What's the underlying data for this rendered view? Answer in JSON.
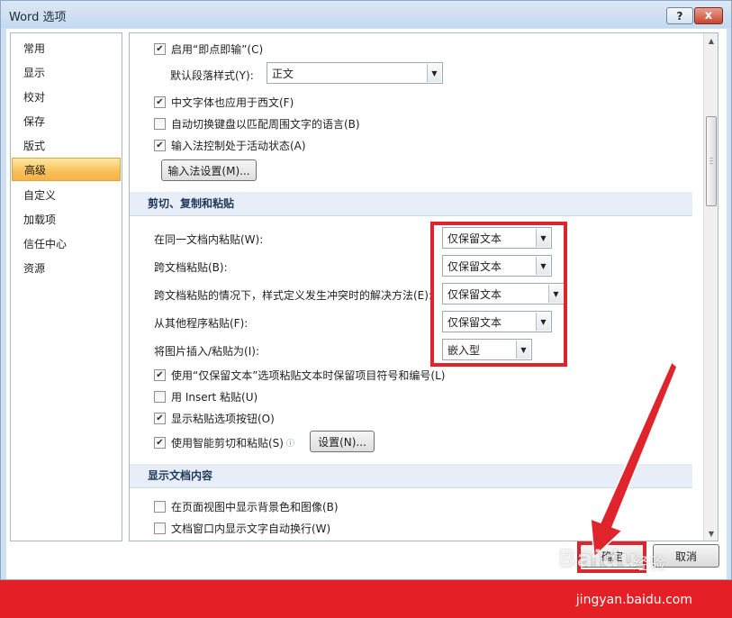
{
  "window": {
    "title": "Word 选项",
    "help_label": "?",
    "close_label": "x"
  },
  "sidebar": {
    "items": [
      {
        "label": "常用"
      },
      {
        "label": "显示"
      },
      {
        "label": "校对"
      },
      {
        "label": "保存"
      },
      {
        "label": "版式"
      },
      {
        "label": "高级",
        "active": true
      },
      {
        "label": "自定义"
      },
      {
        "label": "加载项"
      },
      {
        "label": "信任中心"
      },
      {
        "label": "资源"
      }
    ]
  },
  "editing": {
    "click_and_type": {
      "label": "启用“即点即输”(C)",
      "checked": true
    },
    "default_para_style": {
      "label": "默认段落样式(Y):",
      "value": "正文"
    },
    "chinese_font_west": {
      "label": "中文字体也应用于西文(F)",
      "checked": true
    },
    "auto_switch_keyboard": {
      "label": "自动切换键盘以匹配周围文字的语言(B)",
      "checked": false
    },
    "ime_control": {
      "label": "输入法控制处于活动状态(A)",
      "checked": true
    },
    "ime_settings_button": "输入法设置(M)..."
  },
  "cut_copy_paste": {
    "section_title": "剪切、复制和粘贴",
    "options": [
      {
        "label": "在同一文档内粘贴(W):",
        "value": "仅保留文本"
      },
      {
        "label": "跨文档粘贴(B):",
        "value": "仅保留文本"
      },
      {
        "label": "跨文档粘贴的情况下，样式定义发生冲突时的解决方法(E):",
        "value": "仅保留文本"
      },
      {
        "label": "从其他程序粘贴(F):",
        "value": "仅保留文本"
      },
      {
        "label": "将图片插入/粘贴为(I):",
        "value": "嵌入型"
      }
    ],
    "keep_bullets": {
      "label": "使用“仅保留文本”选项粘贴文本时保留项目符号和编号(L)",
      "checked": true
    },
    "insert_paste": {
      "label": "用 Insert 粘贴(U)",
      "checked": false
    },
    "show_paste_options": {
      "label": "显示粘贴选项按钮(O)",
      "checked": true
    },
    "smart_cut_paste": {
      "label": "使用智能剪切和粘贴(S)",
      "checked": true
    },
    "settings_button": "设置(N)..."
  },
  "show_document": {
    "section_title": "显示文档内容",
    "bg_colors": {
      "label": "在页面视图中显示背景色和图像(B)",
      "checked": false
    },
    "wrap_text": {
      "label": "文档窗口内显示文字自动换行(W)",
      "checked": false
    }
  },
  "footer": {
    "ok_label": "确定",
    "cancel_label": "取消"
  },
  "watermark": {
    "brand": "Baidu",
    "brand_cn": "经验",
    "url": "jingyan.baidu.com"
  },
  "colors": {
    "highlight": "#e0242c",
    "banner": "#e41f26",
    "active_tab": "#f9c25a"
  }
}
